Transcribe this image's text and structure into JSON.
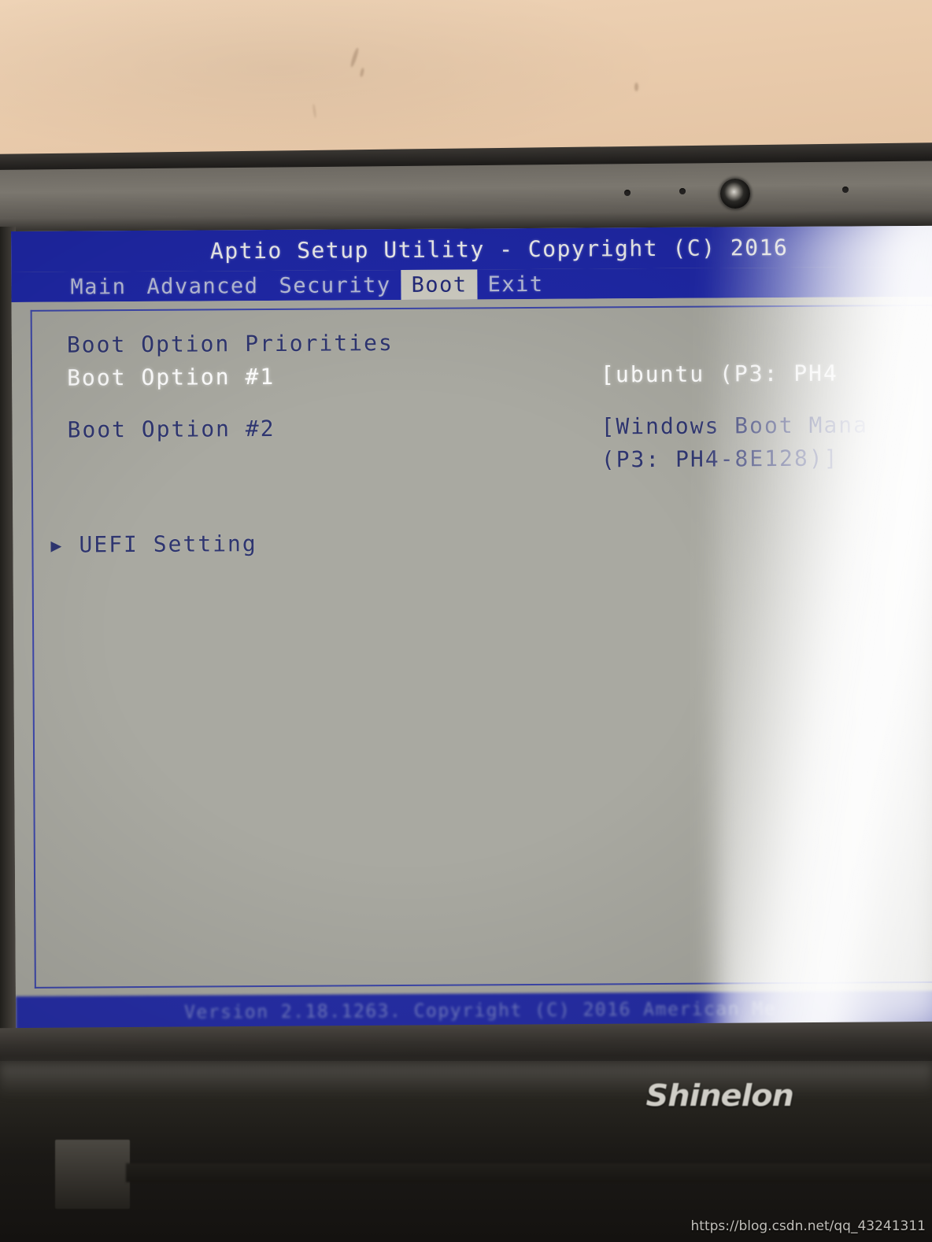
{
  "scene": {
    "device_brand": "Shinelon",
    "watermark": "https://blog.csdn.net/qq_43241311"
  },
  "bios": {
    "title": "Aptio Setup Utility - Copyright (C) 2016",
    "menu_tabs": [
      {
        "label": "Main",
        "active": false
      },
      {
        "label": "Advanced",
        "active": false
      },
      {
        "label": "Security",
        "active": false
      },
      {
        "label": "Boot",
        "active": true
      },
      {
        "label": "Exit",
        "active": false
      }
    ],
    "section_heading": "Boot Option Priorities",
    "boot_options": [
      {
        "label": "Boot Option #1",
        "value": "[ubuntu (P3: PH4",
        "value_line2": "",
        "selected": true
      },
      {
        "label": "Boot Option #2",
        "value": "[Windows Boot Mana",
        "value_line2": "(P3: PH4-8E128)]",
        "selected": false
      }
    ],
    "submenu": {
      "arrow": "▶",
      "label": "UEFI Setting"
    },
    "footer": "Version 2.18.1263. Copyright (C) 2016 American Me",
    "colors": {
      "title_bar": "#1f28a8",
      "screen_bg": "#a9a9a1",
      "text_dim": "#2e3570",
      "text_selected": "#ffffff",
      "active_tab_bg": "#cfcdc3"
    }
  }
}
